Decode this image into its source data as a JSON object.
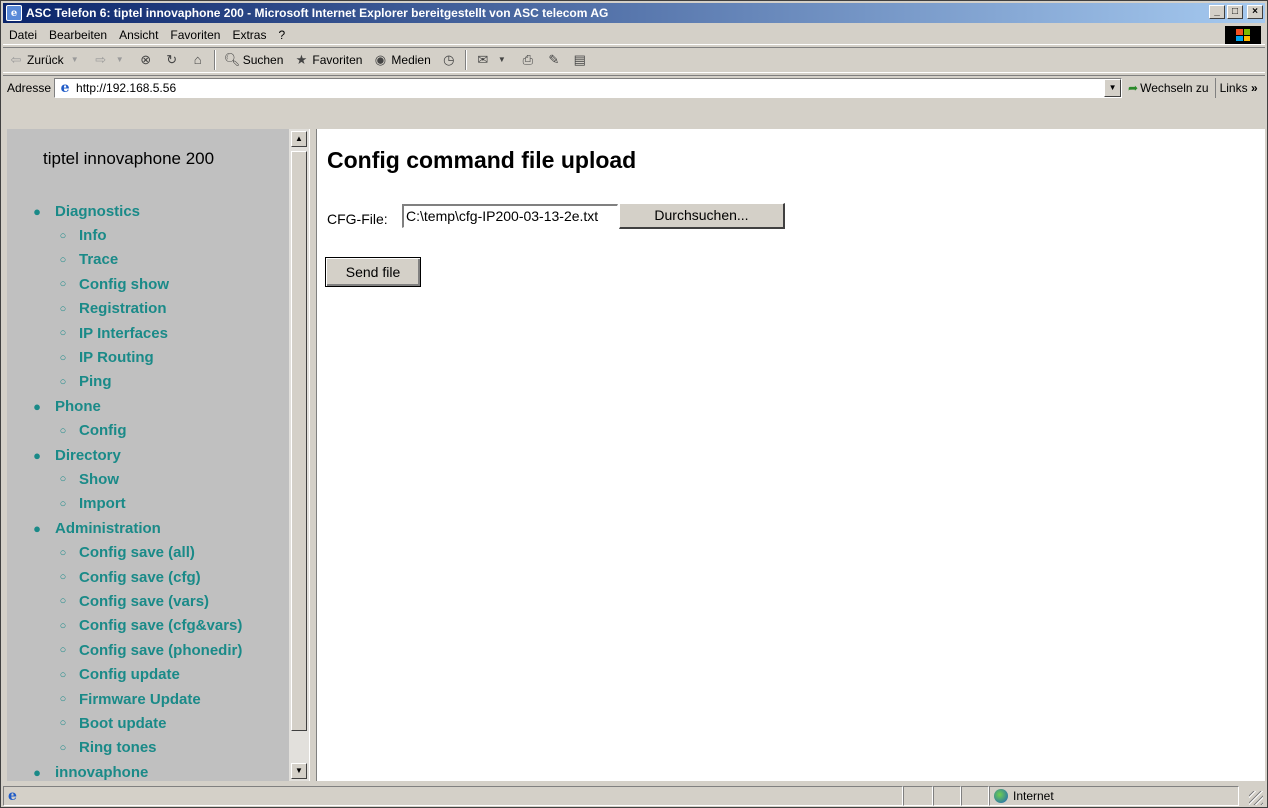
{
  "window": {
    "title": "ASC Telefon 6: tiptel innovaphone 200 - Microsoft Internet Explorer bereitgestellt von ASC telecom AG",
    "controls": [
      "_",
      "□",
      "×"
    ]
  },
  "menubar": {
    "items": [
      "Datei",
      "Bearbeiten",
      "Ansicht",
      "Favoriten",
      "Extras",
      "?"
    ]
  },
  "toolbar": {
    "back": "Zurück",
    "search": "Suchen",
    "favorites": "Favoriten",
    "media": "Medien"
  },
  "addressbar": {
    "label": "Adresse",
    "url": "http://192.168.5.56",
    "goto": "Wechseln zu",
    "links": "Links"
  },
  "sidebar": {
    "title": "tiptel innovaphone 200",
    "items": [
      {
        "label": "Diagnostics",
        "level": 1
      },
      {
        "label": "Info",
        "level": 2
      },
      {
        "label": "Trace",
        "level": 2
      },
      {
        "label": "Config show",
        "level": 2
      },
      {
        "label": "Registration",
        "level": 2
      },
      {
        "label": "IP Interfaces",
        "level": 2
      },
      {
        "label": "IP Routing",
        "level": 2
      },
      {
        "label": "Ping",
        "level": 2
      },
      {
        "label": "Phone",
        "level": 1
      },
      {
        "label": "Config",
        "level": 2
      },
      {
        "label": "Directory",
        "level": 1
      },
      {
        "label": "Show",
        "level": 2
      },
      {
        "label": "Import",
        "level": 2
      },
      {
        "label": "Administration",
        "level": 1
      },
      {
        "label": "Config save (all)",
        "level": 2
      },
      {
        "label": "Config save (cfg)",
        "level": 2
      },
      {
        "label": "Config save (vars)",
        "level": 2
      },
      {
        "label": "Config save (cfg&vars)",
        "level": 2
      },
      {
        "label": "Config save (phonedir)",
        "level": 2
      },
      {
        "label": "Config update",
        "level": 2
      },
      {
        "label": "Firmware Update",
        "level": 2
      },
      {
        "label": "Boot update",
        "level": 2
      },
      {
        "label": "Ring tones",
        "level": 2
      },
      {
        "label": "innovaphone",
        "level": 1
      }
    ]
  },
  "main": {
    "title": "Config command file upload",
    "file_label": "CFG-File:",
    "file_value": "C:\\temp\\cfg-IP200-03-13-2e.txt",
    "browse_label": "Durchsuchen...",
    "send_label": "Send file"
  },
  "statusbar": {
    "zone": "Internet"
  },
  "colors": {
    "title_gradient_start": "#0a246a",
    "title_gradient_end": "#a6caf0",
    "nav_link": "#1a8a88",
    "chrome": "#d4d0c8",
    "sidebar_bg": "#c0c0c0"
  }
}
